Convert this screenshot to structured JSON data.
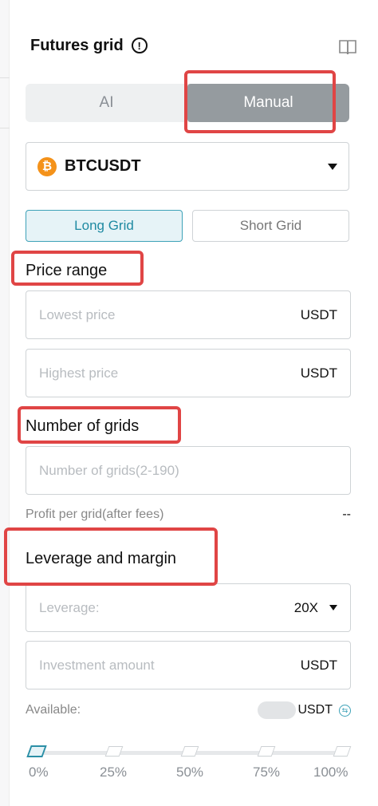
{
  "header": {
    "title": "Futures grid",
    "info_icon": "!",
    "guide_icon": "book-icon"
  },
  "mode_tabs": [
    {
      "label": "AI",
      "active": false
    },
    {
      "label": "Manual",
      "active": true
    }
  ],
  "symbol": {
    "icon": "btc-icon",
    "icon_glyph": "₿",
    "name": "BTCUSDT"
  },
  "grid_type": [
    {
      "label": "Long Grid",
      "active": true
    },
    {
      "label": "Short Grid",
      "active": false
    }
  ],
  "price_range": {
    "label": "Price range",
    "lowest_placeholder": "Lowest price",
    "highest_placeholder": "Highest price",
    "unit": "USDT"
  },
  "grids": {
    "label": "Number of grids",
    "placeholder": "Number of grids(2-190)",
    "profit_label": "Profit per grid(after fees)",
    "profit_value": "--"
  },
  "leverage_margin": {
    "label": "Leverage and margin",
    "leverage_label": "Leverage:",
    "leverage_value": "20X",
    "investment_placeholder": "Investment amount",
    "unit": "USDT",
    "available_label": "Available:",
    "available_unit": "USDT"
  },
  "slider": {
    "value_percent": 0,
    "marks": [
      "0%",
      "25%",
      "50%",
      "75%",
      "100%"
    ]
  },
  "colors": {
    "accent": "#1f8aa2",
    "highlight": "#e04545",
    "btc": "#f4921a"
  }
}
